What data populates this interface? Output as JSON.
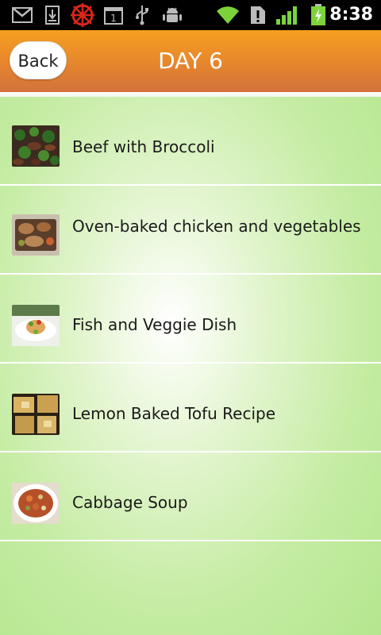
{
  "status_bar": {
    "time": "8:38",
    "battery_color": "#7cd23b",
    "signal_color": "#7cd23b",
    "icons": [
      "gmail-icon",
      "download-icon",
      "settings-wheel-icon",
      "calendar-icon",
      "usb-icon",
      "android-debug-icon",
      "wifi-icon",
      "alert-icon",
      "signal-icon",
      "battery-icon"
    ],
    "calendar_day": "1"
  },
  "header": {
    "back_label": "Back",
    "title": "DAY 6",
    "accent_color": "#f59f20"
  },
  "recipes": [
    {
      "label": "Beef with Broccoli",
      "thumb": "beef-broccoli-photo"
    },
    {
      "label": "Oven-baked chicken and vegetables",
      "thumb": "chicken-vegetables-photo"
    },
    {
      "label": "Fish and Veggie Dish",
      "thumb": "fish-veggie-photo"
    },
    {
      "label": "Lemon Baked Tofu Recipe",
      "thumb": "lemon-tofu-photo"
    },
    {
      "label": "Cabbage Soup",
      "thumb": "cabbage-soup-photo"
    }
  ]
}
